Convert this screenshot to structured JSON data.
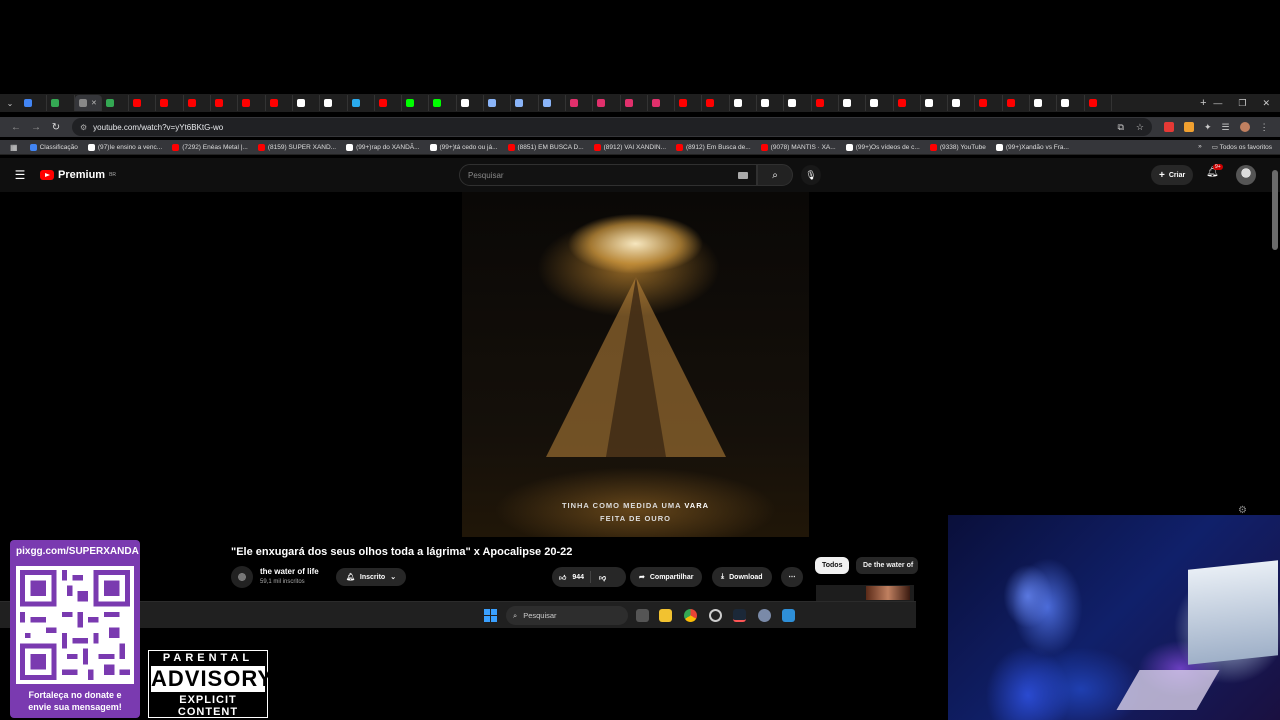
{
  "browser": {
    "tab_colors": [
      "#4285f4",
      "#34a853",
      "#888888",
      "#34a853",
      "#ff0000",
      "#ff0000",
      "#ff0000",
      "#ff0000",
      "#ff0000",
      "#ff0000",
      "#ffffff",
      "#ffffff",
      "#2aabee",
      "#ff0000",
      "#00ff00",
      "#00ff00",
      "#ffffff",
      "#8ab4f8",
      "#8ab4f8",
      "#8ab4f8",
      "#e1306c",
      "#e1306c",
      "#e1306c",
      "#e1306c",
      "#ff0000",
      "#ff0000",
      "#ffffff",
      "#ffffff",
      "#ffffff",
      "#ff0000",
      "#ffffff",
      "#ffffff",
      "#ff0000",
      "#ffffff",
      "#ffffff",
      "#ff0000",
      "#ff0000",
      "#ffffff",
      "#ffffff",
      "#ff0000"
    ],
    "url": "youtube.com/watch?v=yYt6BKtG-wo",
    "bookmarks": [
      {
        "label": "Classificação",
        "color": "#4285f4"
      },
      {
        "label": "(97)Ie ensino a venc...",
        "color": "#ffffff"
      },
      {
        "label": "(7292) Enéas Metal |...",
        "color": "#ff0000"
      },
      {
        "label": "(8159) SUPER XAND...",
        "color": "#ff0000"
      },
      {
        "label": "(99+)rap do XANDÃ...",
        "color": "#ffffff"
      },
      {
        "label": "(99+)tá cedo ou já...",
        "color": "#ffffff"
      },
      {
        "label": "(8851) EM BUSCA D...",
        "color": "#ff0000"
      },
      {
        "label": "(8912) VAI XANDIN...",
        "color": "#ff0000"
      },
      {
        "label": "(8912) Em Busca de...",
        "color": "#ff0000"
      },
      {
        "label": "(9078) MANTIS · XA...",
        "color": "#ff0000"
      },
      {
        "label": "(99+)Os vídeos de c...",
        "color": "#ffffff"
      },
      {
        "label": "(9338) YouTube",
        "color": "#ff0000"
      },
      {
        "label": "(99+)Xandão vs Fra...",
        "color": "#ffffff"
      }
    ],
    "all_favorites": "Todos os favoritos"
  },
  "youtube": {
    "logo": "Premium",
    "logo_region": "BR",
    "search_placeholder": "Pesquisar",
    "create_label": "Criar",
    "notif_badge": "9+",
    "video": {
      "caption_line1_a": "TINHA COMO MEDIDA UMA ",
      "caption_line1_b": "VARA",
      "caption_line2": "FEITA DE OURO"
    },
    "title": "\"Ele enxugará dos seus olhos toda a lágrima\" x Apocalipse 20-22",
    "channel": "the water of life",
    "subs": "59,1 mil inscritos",
    "subscribe_label": "Inscrito",
    "likes": "944",
    "share_label": "Compartilhar",
    "download_label": "Download",
    "chips": [
      "Todos",
      "De the water of"
    ]
  },
  "taskbar": {
    "search_label": "Pesquisar"
  },
  "overlay": {
    "donate_url": "pixgg.com/SUPERXANDA",
    "donate_msg_1": "Fortaleça no donate e",
    "donate_msg_2": "envie sua mensagem!",
    "advisory_1": "PARENTAL",
    "advisory_2": "ADVISORY",
    "advisory_3": "EXPLICIT CONTENT"
  },
  "colors": {
    "yt_red": "#ff0000",
    "donate_purple": "#7a3ab0"
  }
}
